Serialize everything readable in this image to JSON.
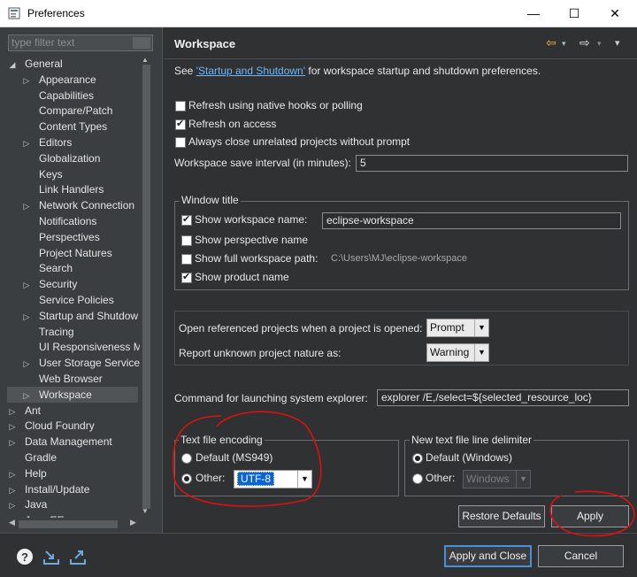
{
  "window": {
    "title": "Preferences",
    "minimize": "—",
    "maximize": "☐",
    "close": "✕"
  },
  "sidebar": {
    "filter_placeholder": "type filter text",
    "items": [
      {
        "label": "General",
        "expander": "◢",
        "indent": 0
      },
      {
        "label": "Appearance",
        "expander": "▷",
        "indent": 1
      },
      {
        "label": "Capabilities",
        "expander": "",
        "indent": 1
      },
      {
        "label": "Compare/Patch",
        "expander": "",
        "indent": 1
      },
      {
        "label": "Content Types",
        "expander": "",
        "indent": 1
      },
      {
        "label": "Editors",
        "expander": "▷",
        "indent": 1
      },
      {
        "label": "Globalization",
        "expander": "",
        "indent": 1
      },
      {
        "label": "Keys",
        "expander": "",
        "indent": 1
      },
      {
        "label": "Link Handlers",
        "expander": "",
        "indent": 1
      },
      {
        "label": "Network Connection",
        "expander": "▷",
        "indent": 1
      },
      {
        "label": "Notifications",
        "expander": "",
        "indent": 1
      },
      {
        "label": "Perspectives",
        "expander": "",
        "indent": 1
      },
      {
        "label": "Project Natures",
        "expander": "",
        "indent": 1
      },
      {
        "label": "Search",
        "expander": "",
        "indent": 1
      },
      {
        "label": "Security",
        "expander": "▷",
        "indent": 1
      },
      {
        "label": "Service Policies",
        "expander": "",
        "indent": 1
      },
      {
        "label": "Startup and Shutdow",
        "expander": "▷",
        "indent": 1
      },
      {
        "label": "Tracing",
        "expander": "",
        "indent": 1
      },
      {
        "label": "UI Responsiveness M",
        "expander": "",
        "indent": 1
      },
      {
        "label": "User Storage Service",
        "expander": "▷",
        "indent": 1
      },
      {
        "label": "Web Browser",
        "expander": "",
        "indent": 1
      },
      {
        "label": "Workspace",
        "expander": "▷",
        "indent": 1,
        "selected": true
      },
      {
        "label": "Ant",
        "expander": "▷",
        "indent": 0
      },
      {
        "label": "Cloud Foundry",
        "expander": "▷",
        "indent": 0
      },
      {
        "label": "Data Management",
        "expander": "▷",
        "indent": 0
      },
      {
        "label": "Gradle",
        "expander": "",
        "indent": 0
      },
      {
        "label": "Help",
        "expander": "▷",
        "indent": 0
      },
      {
        "label": "Install/Update",
        "expander": "▷",
        "indent": 0
      },
      {
        "label": "Java",
        "expander": "▷",
        "indent": 0
      },
      {
        "label": "Java EE",
        "expander": "▷",
        "indent": 0
      }
    ]
  },
  "page": {
    "title": "Workspace",
    "nav_back": "⇦",
    "nav_forward": "⇨",
    "nav_menu": "▾",
    "see_prefix": "See ",
    "see_link": "'Startup and Shutdown'",
    "see_suffix": " for workspace startup and shutdown preferences.",
    "refresh_native": "Refresh using native hooks or polling",
    "refresh_access": "Refresh on access",
    "always_close": "Always close unrelated projects without prompt",
    "save_interval_label": "Workspace save interval (in minutes):",
    "save_interval_value": "5",
    "window_title_group": "Window title",
    "show_ws_name": "Show workspace name:",
    "ws_name_value": "eclipse-workspace",
    "show_perspective": "Show perspective name",
    "show_full_path": "Show full workspace path:",
    "full_path_value": "C:\\Users\\MJ\\eclipse-workspace",
    "show_product": "Show product name",
    "open_ref_label": "Open referenced projects when a project is opened:",
    "open_ref_value": "Prompt",
    "report_unknown_label": "Report unknown project nature as:",
    "report_unknown_value": "Warning",
    "cmd_label": "Command for launching system explorer:",
    "cmd_value": "explorer /E,/select=${selected_resource_loc}",
    "encoding_group": "Text file encoding",
    "encoding_default": "Default (MS949)",
    "encoding_other": "Other:",
    "encoding_value": "UTF-8",
    "delimiter_group": "New text file line delimiter",
    "delimiter_default": "Default (Windows)",
    "delimiter_other": "Other:",
    "delimiter_value": "Windows",
    "restore_defaults": "Restore Defaults",
    "apply": "Apply"
  },
  "footer": {
    "help_icon": "?",
    "apply_close": "Apply and Close",
    "cancel": "Cancel"
  },
  "colors": {
    "annotation": "#e01010",
    "link": "#6fb7ff",
    "selection": "#505457"
  }
}
